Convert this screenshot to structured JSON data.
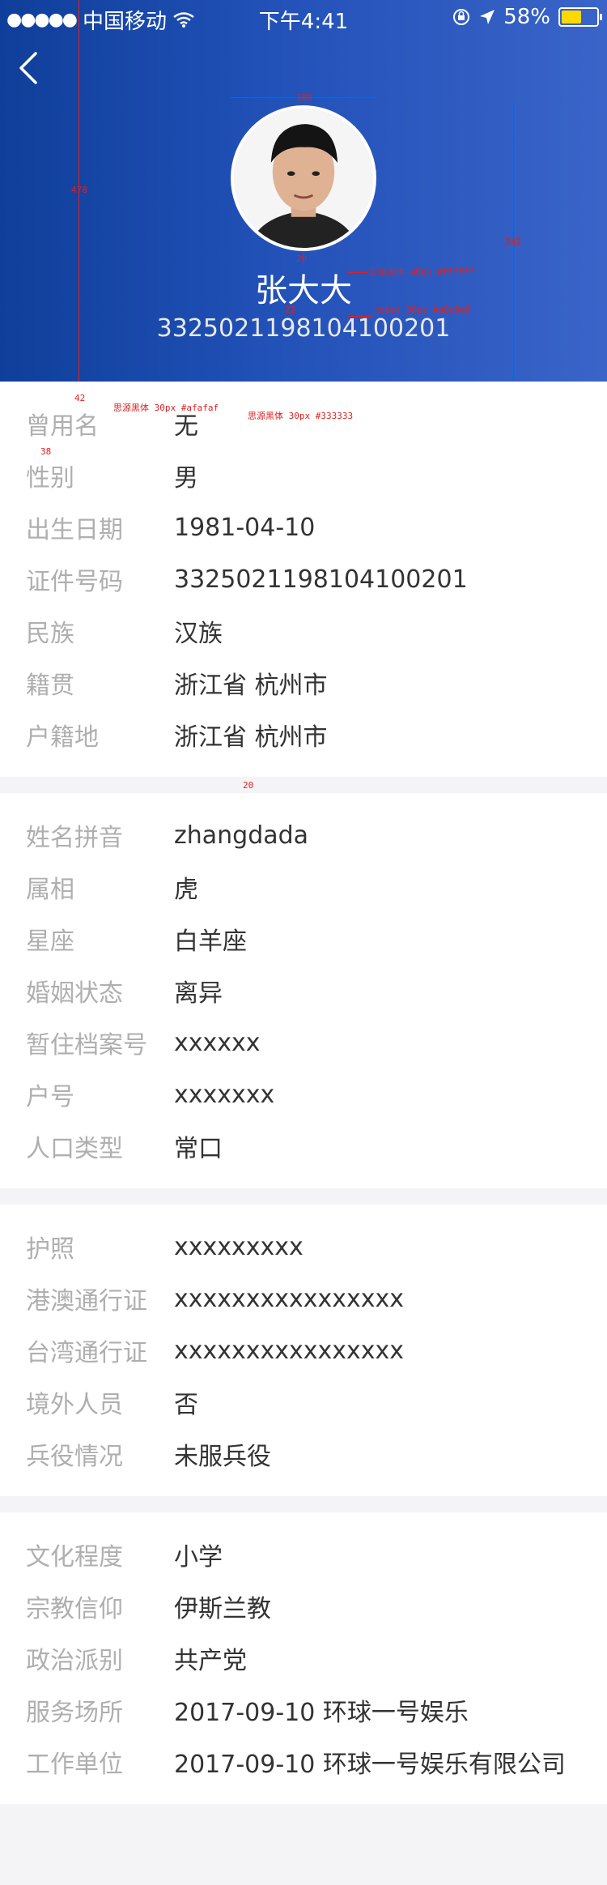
{
  "status": {
    "carrier": "中国移动",
    "time": "下午4:41",
    "battery": "58%",
    "battery_level": 0.58
  },
  "header": {
    "name": "张大大",
    "id_number": "3325021198104100201"
  },
  "annotations": {
    "avatar_size": "180",
    "left_height": "478",
    "right_height": "342",
    "name_gap": "20",
    "name_font": "思源黑体 40px #ffffff",
    "id_gap": "22",
    "id_font": "robot 30px #e8e8e8",
    "list_top": "42",
    "label_font": "思源黑体 30px #afafaf",
    "value_font": "思源黑体 30px #333333",
    "row_gap": "38",
    "section_gap": "20"
  },
  "sections": [
    {
      "rows": [
        {
          "label": "曾用名",
          "value": "无"
        },
        {
          "label": "性别",
          "value": "男"
        },
        {
          "label": "出生日期",
          "value": "1981-04-10"
        },
        {
          "label": "证件号码",
          "value": "3325021198104100201"
        },
        {
          "label": "民族",
          "value": "汉族"
        },
        {
          "label": "籍贯",
          "value": "浙江省 杭州市"
        },
        {
          "label": "户籍地",
          "value": "浙江省 杭州市"
        }
      ]
    },
    {
      "rows": [
        {
          "label": "姓名拼音",
          "value": "zhangdada"
        },
        {
          "label": "属相",
          "value": "虎"
        },
        {
          "label": "星座",
          "value": "白羊座"
        },
        {
          "label": "婚姻状态",
          "value": "离异"
        },
        {
          "label": "暂住档案号",
          "value": "xxxxxx"
        },
        {
          "label": "户号",
          "value": "xxxxxxx"
        },
        {
          "label": "人口类型",
          "value": "常口"
        }
      ]
    },
    {
      "rows": [
        {
          "label": "护照",
          "value": "xxxxxxxxx"
        },
        {
          "label": "港澳通行证",
          "value": "xxxxxxxxxxxxxxxx"
        },
        {
          "label": "台湾通行证",
          "value": "xxxxxxxxxxxxxxxx"
        },
        {
          "label": "境外人员",
          "value": "否"
        },
        {
          "label": "兵役情况",
          "value": "未服兵役"
        }
      ]
    },
    {
      "rows": [
        {
          "label": "文化程度",
          "value": "小学"
        },
        {
          "label": "宗教信仰",
          "value": "伊斯兰教"
        },
        {
          "label": "政治派别",
          "value": "共产党"
        },
        {
          "label": "服务场所",
          "value": "2017-09-10  环球一号娱乐"
        },
        {
          "label": "工作单位",
          "value": "2017-09-10  环球一号娱乐有限公司"
        }
      ]
    }
  ]
}
